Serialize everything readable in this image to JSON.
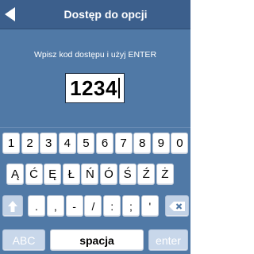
{
  "header": {
    "title": "Dostęp do opcji",
    "back_icon": "back-arrow-icon"
  },
  "prompt": "Wpisz kod dostępu i użyj ENTER",
  "code_input": {
    "value": "1234"
  },
  "keyboard": {
    "row1": [
      "1",
      "2",
      "3",
      "4",
      "5",
      "6",
      "7",
      "8",
      "9",
      "0"
    ],
    "row2": [
      "Ą",
      "Ć",
      "Ę",
      "Ł",
      "Ń",
      "Ó",
      "Ś",
      "Ź",
      "Ż"
    ],
    "row3": [
      ".",
      ",",
      "-",
      "/",
      ":",
      ";",
      "'"
    ],
    "shift_icon": "shift-arrow-icon",
    "backspace_icon": "backspace-x-icon",
    "abc_label": "ABC",
    "space_label": "spacja",
    "enter_label": "enter"
  },
  "colors": {
    "background": "#5079a6",
    "header": "#3c5f8c",
    "key": "#ffffff",
    "key_light": "#c2d2e6"
  }
}
